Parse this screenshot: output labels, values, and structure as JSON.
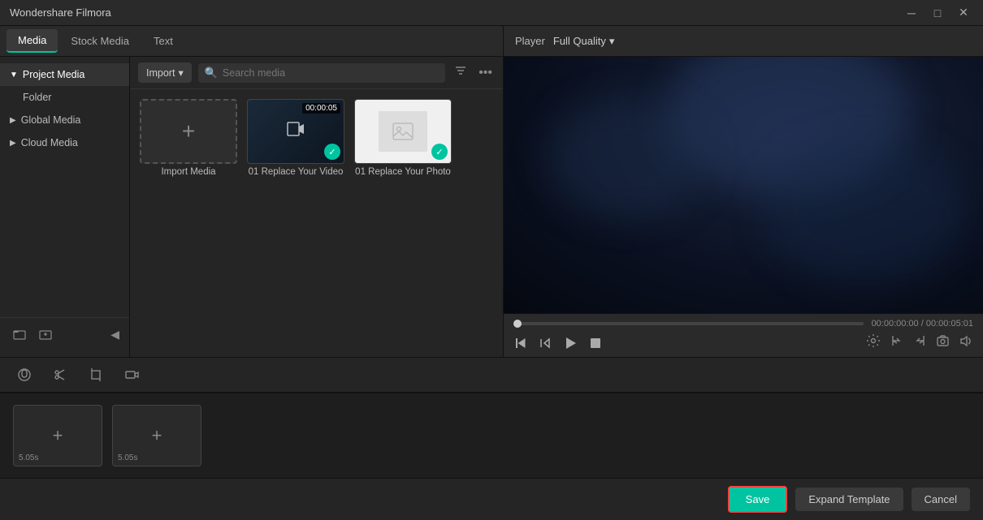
{
  "titlebar": {
    "title": "Wondershare Filmora",
    "minimize": "─",
    "maximize": "□",
    "close": "✕"
  },
  "tabs": [
    {
      "id": "media",
      "label": "Media",
      "active": true
    },
    {
      "id": "stock-media",
      "label": "Stock Media",
      "active": false
    },
    {
      "id": "text",
      "label": "Text",
      "active": false
    }
  ],
  "sidebar": {
    "items": [
      {
        "id": "project-media",
        "label": "Project Media",
        "active": true
      },
      {
        "id": "folder",
        "label": "Folder",
        "active": false
      },
      {
        "id": "global-media",
        "label": "Global Media",
        "active": false
      },
      {
        "id": "cloud-media",
        "label": "Cloud Media",
        "active": false
      }
    ]
  },
  "media_toolbar": {
    "import_label": "Import",
    "search_placeholder": "Search media",
    "filter_icon": "filter",
    "more_icon": "more"
  },
  "media_items": [
    {
      "id": "import",
      "type": "import",
      "label": "Import Media"
    },
    {
      "id": "video1",
      "type": "video",
      "label": "01 Replace Your Video",
      "duration": "00:00:05",
      "checked": true
    },
    {
      "id": "photo1",
      "type": "photo",
      "label": "01 Replace Your Photo",
      "checked": true
    }
  ],
  "player": {
    "label": "Player",
    "quality": "Full Quality",
    "current_time": "00:00:00:00",
    "separator": "/",
    "total_time": "00:00:05:01"
  },
  "controls": {
    "back_frame": "⏮",
    "play_back": "↩",
    "play": "▶",
    "square": "□",
    "settings_icon": "⚙",
    "bracket_left": "{",
    "bracket_right": "}",
    "camera": "📷",
    "volume": "🔊"
  },
  "tools": [
    {
      "id": "audio",
      "icon": "♪"
    },
    {
      "id": "cut",
      "icon": "✂"
    },
    {
      "id": "crop",
      "icon": "⊞"
    },
    {
      "id": "record",
      "icon": "⊙"
    }
  ],
  "timeline": {
    "clips": [
      {
        "id": "clip1",
        "duration": "5.05s"
      },
      {
        "id": "clip2",
        "duration": "5.05s"
      }
    ]
  },
  "footer": {
    "save_label": "Save",
    "expand_label": "Expand Template",
    "cancel_label": "Cancel"
  }
}
